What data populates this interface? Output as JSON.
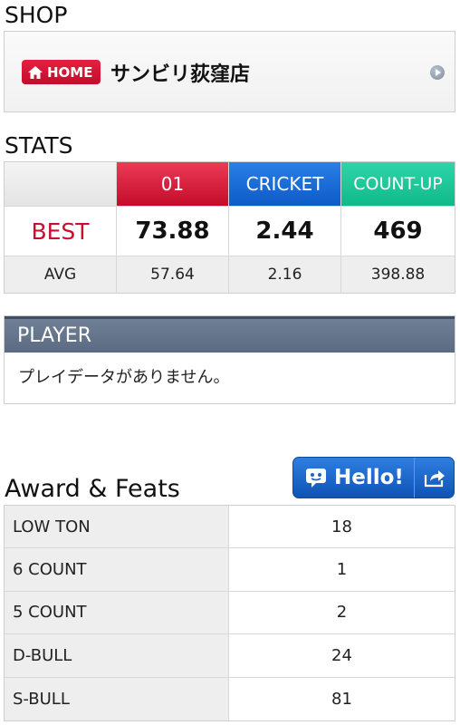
{
  "shop": {
    "title": "SHOP",
    "home_badge": "HOME",
    "home_icon": "home-icon",
    "name": "サンビリ荻窪店",
    "arrow_icon": "arrow-right-circle-icon"
  },
  "stats": {
    "title": "STATS",
    "headers": [
      "",
      "01",
      "CRICKET",
      "COUNT-UP"
    ],
    "header_colors": [
      "#e8e8e8",
      "#d61f3c",
      "#1a6ed8",
      "#1fc79a"
    ],
    "best_label": "BEST",
    "best_values": [
      "73.88",
      "2.44",
      "469"
    ],
    "avg_label": "AVG",
    "avg_values": [
      "57.64",
      "2.16",
      "398.88"
    ],
    "best_color": "#c8102e"
  },
  "player": {
    "title": "PLAYER",
    "message": "プレイデータがありません。"
  },
  "awards": {
    "title": "Award & Feats",
    "hello_label": "Hello!",
    "hello_icon": "chat-bubble-icon",
    "share_icon": "share-icon",
    "rows": [
      {
        "label": "LOW TON",
        "value": "18"
      },
      {
        "label": "6 COUNT",
        "value": "1"
      },
      {
        "label": "5 COUNT",
        "value": "2"
      },
      {
        "label": "D-BULL",
        "value": "24"
      },
      {
        "label": "S-BULL",
        "value": "81"
      }
    ]
  }
}
